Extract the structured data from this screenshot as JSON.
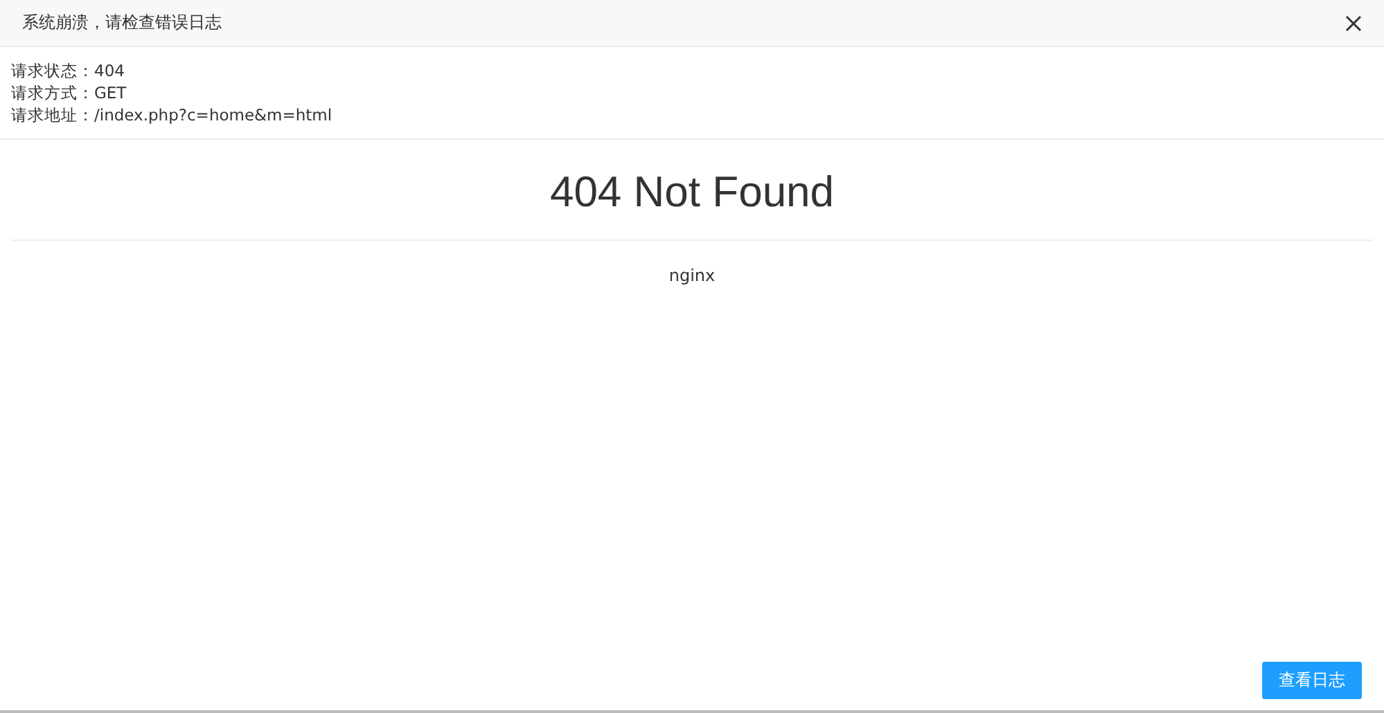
{
  "window": {
    "title": "系统崩溃，请检查错误日志"
  },
  "request_info": [
    "请求状态：404",
    "请求方式：GET",
    "请求地址：/index.php?c=home&m=html"
  ],
  "error_page": {
    "heading": "404 Not Found",
    "server": "nginx"
  },
  "buttons": [
    "查看日志"
  ]
}
